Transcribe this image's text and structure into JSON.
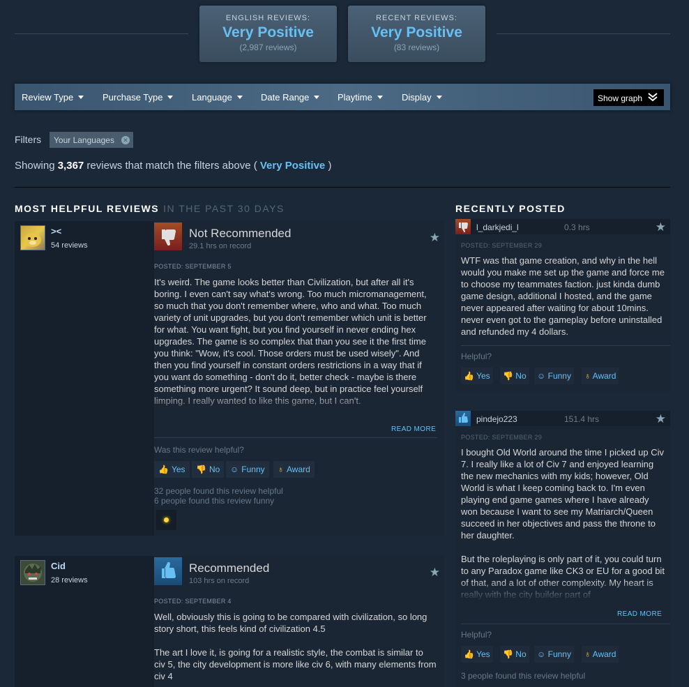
{
  "summary": {
    "english": {
      "label": "English Reviews:",
      "value": "Very Positive",
      "count": "(2,987 reviews)"
    },
    "recent": {
      "label": "Recent Reviews:",
      "value": "Very Positive",
      "count": "(83 reviews)"
    }
  },
  "filter_bar": {
    "review_type": "Review Type",
    "purchase_type": "Purchase Type",
    "language": "Language",
    "date_range": "Date Range",
    "playtime": "Playtime",
    "display": "Display",
    "show_graph": "Show graph"
  },
  "filters": {
    "label": "Filters",
    "chip": "Your Languages",
    "showing_prefix": "Showing ",
    "showing_count": "3,367",
    "showing_mid": " reviews that match the filters above ( ",
    "showing_rating": "Very Positive",
    "showing_suffix": " )"
  },
  "helpful": {
    "title": "MOST HELPFUL REVIEWS",
    "subtitle": "IN THE PAST 30 DAYS",
    "reviews": [
      {
        "persona": "><",
        "reviews_count": "54 reviews",
        "rating": "Not Recommended",
        "hours": "29.1 hrs on record",
        "posted": "POSTED: SEPTEMBER 5",
        "text": "It's weird. The game looks better than Civilization, but after all it's boring. I even can't say what's wrong. Too much micromanagement, so much that you don't remember where, who and what. Too much variety of unit upgrades, but you don't remember which unit is better for what. You want fight, but you find yourself in never ending hex upgrades. The game is so complex that than you see it the first time you think: \"Wow, it's cool. Those orders must be used wisely\". And then you find yourself in constant orders restrictions in a way that if you want do something - don't do it, better check - maybe is there something more urgent? It sound deep, but in practice feel yourself limping. I really wanted to like this game, but I can't.",
        "read_more": "READ MORE",
        "helpful_q": "Was this review helpful?",
        "yes": "Yes",
        "no": "No",
        "funny": "Funny",
        "award": "Award",
        "found_helpful": "32 people found this review helpful",
        "found_funny": "6 people found this review funny"
      },
      {
        "persona": "Cid",
        "reviews_count": "28 reviews",
        "rating": "Recommended",
        "hours": "103 hrs on record",
        "posted": "POSTED: SEPTEMBER 4",
        "text1": "Well, obviously this is going to be compared with civilization, so long story short, this feels kind of civilization 4.5",
        "text2": "The art I love it, is going for a realistic style, the combat is similar to civ 5, the city development is more like civ 6, with many elements from civ 4"
      }
    ]
  },
  "recent": {
    "title": "RECENTLY POSTED",
    "reviews": [
      {
        "persona": "l_darkjedi_l",
        "hours": "0.3 hrs",
        "posted": "POSTED: SEPTEMBER 29",
        "text": "WTF was that game creation, and why in the hell would you make me set up the game and force me to choose my teammates faction. just kinda dumb game design, additional I hosted, and the game never appeared after waiting for about 10mins. never even got to the gameplay before uninstalled and refunded my 4 dollars.",
        "helpful_q": "Helpful?",
        "yes": "Yes",
        "no": "No",
        "funny": "Funny",
        "award": "Award"
      },
      {
        "persona": "pindejo223",
        "hours": "151.4 hrs",
        "posted": "POSTED: SEPTEMBER 29",
        "text1": "I bought Old World around the time I picked up Civ 7. I really like a lot of Civ 7 and enjoyed learning the new mechanics with my kids; however, Old World is what I keep coming back to. I'm even playing end game games where I have already won because I want to see my Matriarch/Queen succeed in her objectives and pass the throne to her daughter.",
        "text2": "But the roleplaying is only part of it, you could turn to any Paradox game like CK3 or EU for a good bit of that, and a lot of other complexity. My heart is really with the city builder part of",
        "read_more": "READ MORE",
        "helpful_q": "Helpful?",
        "yes": "Yes",
        "no": "No",
        "funny": "Funny",
        "award": "Award",
        "found_helpful": "3 people found this review helpful"
      }
    ]
  },
  "colors": {
    "background": "#1b2838",
    "accent": "#66c0f4",
    "negative": "#a34c25",
    "positive": "#2a6a9c"
  }
}
